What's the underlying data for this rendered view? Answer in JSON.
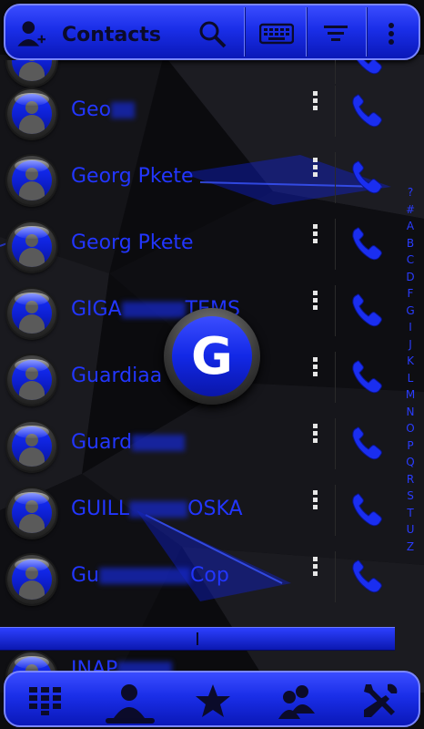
{
  "app": {
    "title": "Contacts",
    "accent_color": "#1f33ff",
    "text_color": "#2236ff"
  },
  "toolbar": {
    "icons": [
      "add-contact-icon",
      "search-icon",
      "keyboard-icon",
      "sort-icon",
      "overflow-menu-icon"
    ]
  },
  "contacts": [
    {
      "name_visible": "",
      "index": 0
    },
    {
      "name_visible": "Geo",
      "index": 1
    },
    {
      "name_visible": "Georg   Pkete",
      "index": 2
    },
    {
      "name_visible": "Georg   Pkete",
      "index": 3
    },
    {
      "name_visible": "GIGA",
      "name_tail": "TEMS",
      "index": 4
    },
    {
      "name_visible": "Guardiaa",
      "index": 5
    },
    {
      "name_visible": "Guard",
      "index": 6
    },
    {
      "name_visible": "GUILL",
      "name_tail": "OSKA",
      "index": 7
    },
    {
      "name_visible": "Gu",
      "name_tail": "Cop",
      "index": 8
    }
  ],
  "peek_contact": "INAP",
  "fast_scroll_letter": "G",
  "alphabet_index": [
    "?",
    "#",
    "A",
    "B",
    "C",
    "D",
    "F",
    "G",
    "I",
    "J",
    "K",
    "L",
    "M",
    "N",
    "O",
    "P",
    "Q",
    "R",
    "S",
    "T",
    "U",
    "Z"
  ],
  "bottom_tabs": [
    {
      "icon": "dialpad-icon",
      "active": false
    },
    {
      "icon": "contact-icon",
      "active": true
    },
    {
      "icon": "favorites-star-icon",
      "active": false
    },
    {
      "icon": "groups-icon",
      "active": false
    },
    {
      "icon": "settings-tools-icon",
      "active": false
    }
  ]
}
